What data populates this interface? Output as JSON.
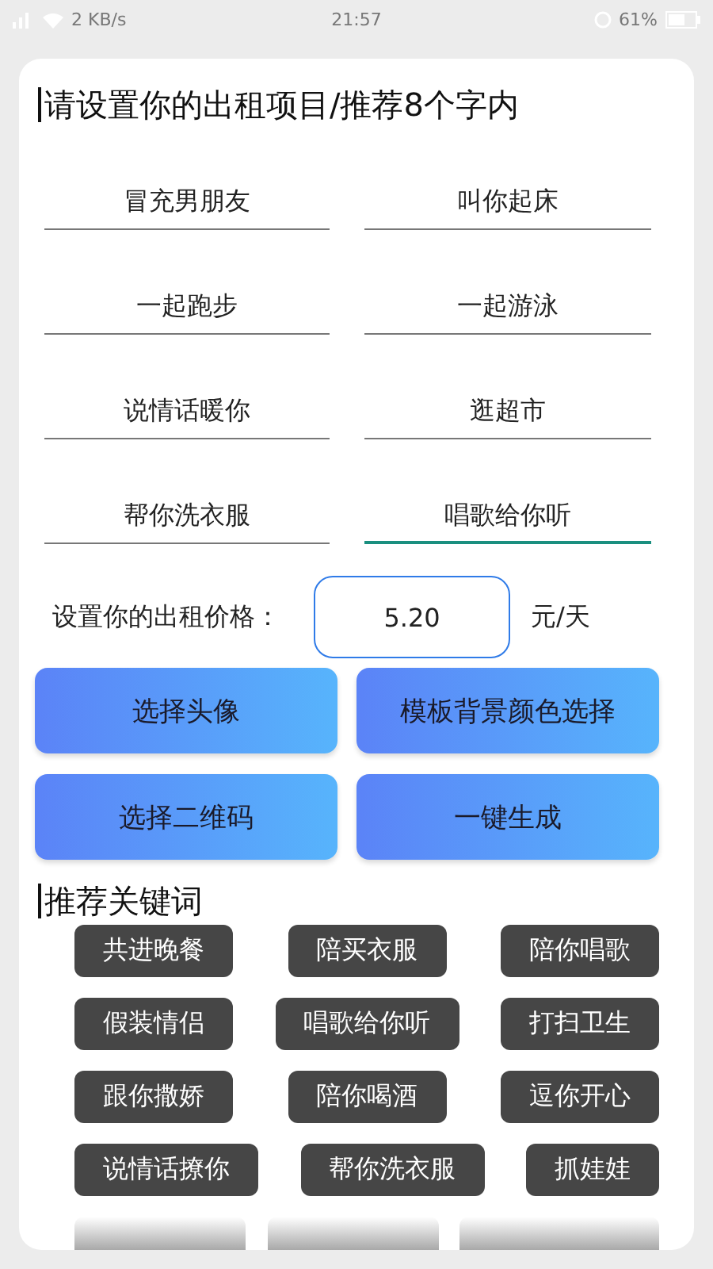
{
  "status_bar": {
    "speed": "2 KB/s",
    "time": "21:57",
    "battery": "61%"
  },
  "title": "请设置你的出租项目/推荐8个字内",
  "fields": [
    {
      "value": "冒充男朋友",
      "focused": false
    },
    {
      "value": "叫你起床",
      "focused": false
    },
    {
      "value": "一起跑步",
      "focused": false
    },
    {
      "value": "一起游泳",
      "focused": false
    },
    {
      "value": "说情话暖你",
      "focused": false
    },
    {
      "value": "逛超市",
      "focused": false
    },
    {
      "value": "帮你洗衣服",
      "focused": false
    },
    {
      "value": "唱歌给你听",
      "focused": true
    }
  ],
  "price": {
    "label": "设置你的出租价格：",
    "value": "5.20",
    "unit": "元/天"
  },
  "buttons": [
    "选择头像",
    "模板背景颜色选择",
    "选择二维码",
    "一键生成"
  ],
  "keywords_title": "推荐关键词",
  "keyword_rows": [
    [
      "共进晚餐",
      "陪买衣服",
      "陪你唱歌"
    ],
    [
      "假装情侣",
      "唱歌给你听",
      "打扫卫生"
    ],
    [
      "跟你撒娇",
      "陪你喝酒",
      "逗你开心"
    ],
    [
      "说情话撩你",
      "帮你洗衣服",
      "抓娃娃"
    ]
  ]
}
